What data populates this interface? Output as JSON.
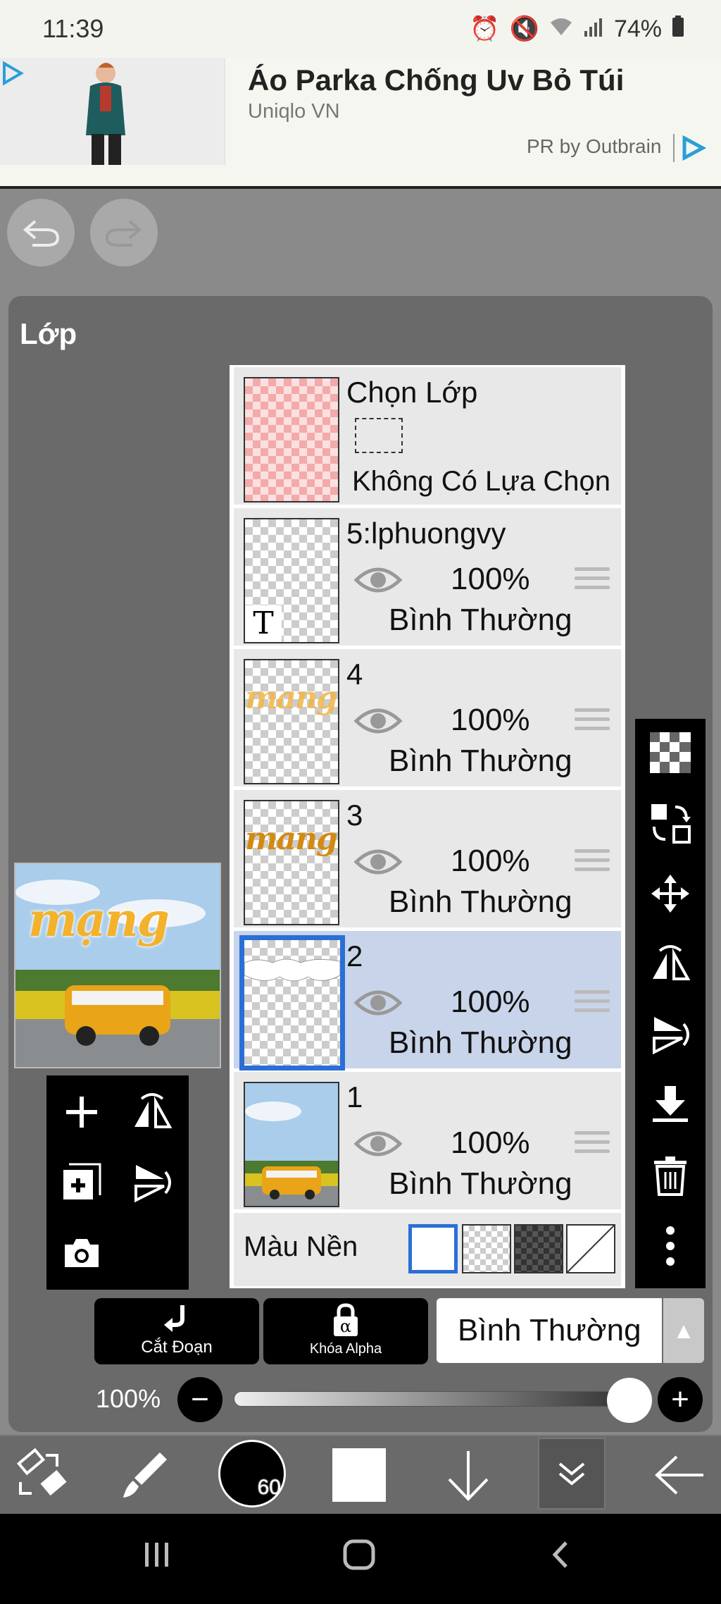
{
  "status": {
    "time": "11:39",
    "battery": "74%"
  },
  "ad": {
    "title": "Áo Parka Chống Uv Bỏ Túi",
    "source": "Uniqlo VN",
    "pr": "PR by Outbrain"
  },
  "panel": {
    "title": "Lớp"
  },
  "selection_layer": {
    "title": "Chọn Lớp",
    "subtitle": "Không Có Lựa Chọn"
  },
  "layers": [
    {
      "name": "5:lphuongvy",
      "opacity": "100%",
      "blend": "Bình Thường"
    },
    {
      "name": "4",
      "opacity": "100%",
      "blend": "Bình Thường"
    },
    {
      "name": "3",
      "opacity": "100%",
      "blend": "Bình Thường"
    },
    {
      "name": "2",
      "opacity": "100%",
      "blend": "Bình Thường"
    },
    {
      "name": "1",
      "opacity": "100%",
      "blend": "Bình Thường"
    }
  ],
  "background": {
    "label": "Màu Nền"
  },
  "thumb_text": {
    "t_glyph": "T",
    "mang": "mang",
    "preview_title": "mạng"
  },
  "controls": {
    "clip_label": "Cắt Đoạn",
    "alpha_label": "Khóa Alpha",
    "alpha_glyph": "α",
    "blend_mode": "Bình Thường",
    "opacity": "100%",
    "minus": "−",
    "plus": "+"
  },
  "toolbar": {
    "brush_size": "60"
  },
  "colors": {
    "selected_row": "#c8d4ea",
    "accent": "#2a6fd6",
    "panel": "#6a6a6a"
  }
}
